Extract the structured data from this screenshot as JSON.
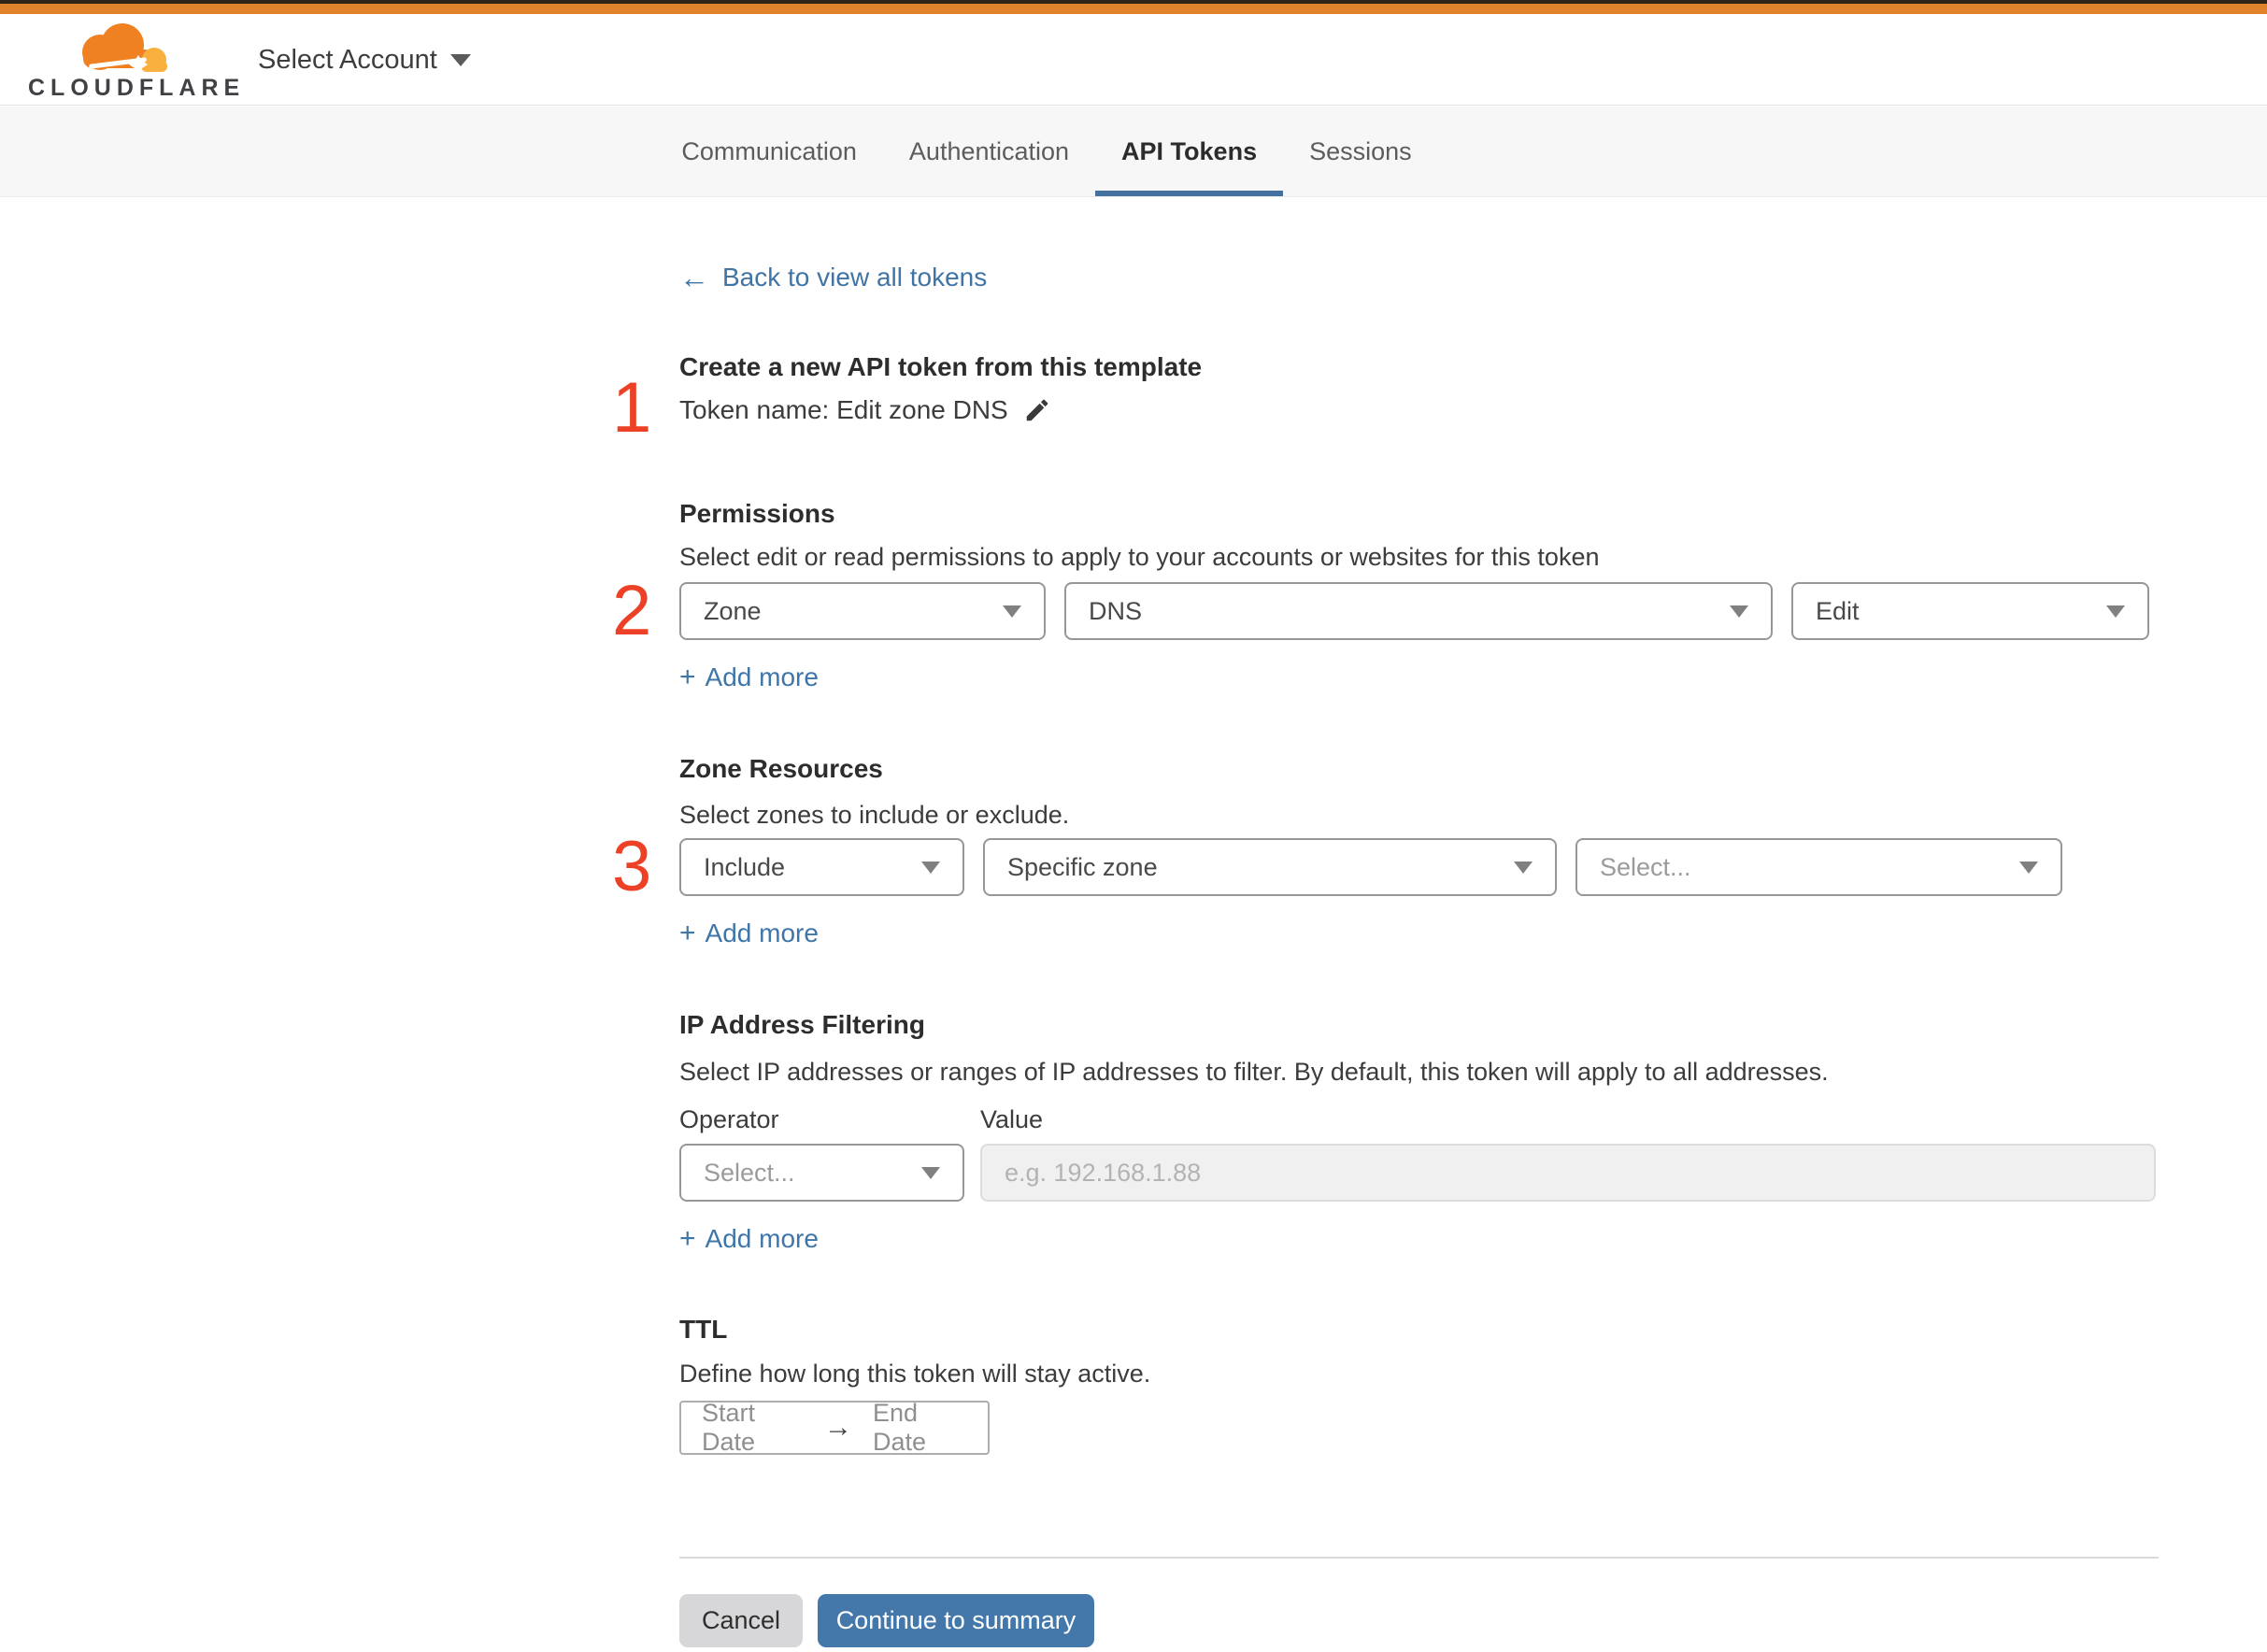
{
  "header": {
    "logo_text": "CLOUDFLARE",
    "account_selector": {
      "label": "Select Account"
    }
  },
  "tabs": [
    {
      "label": "Communication",
      "active": false
    },
    {
      "label": "Authentication",
      "active": false
    },
    {
      "label": "API Tokens",
      "active": true
    },
    {
      "label": "Sessions",
      "active": false
    }
  ],
  "back_link": {
    "arrow": "←",
    "label": "Back to view all tokens"
  },
  "create_section": {
    "step_number": "1",
    "title": "Create a new API token from this template",
    "token_name": "Token name: Edit zone DNS"
  },
  "permissions": {
    "step_number": "2",
    "title": "Permissions",
    "description": "Select edit or read permissions to apply to your accounts or websites for this token",
    "scope_value": "Zone",
    "service_value": "DNS",
    "access_value": "Edit",
    "add_more": {
      "plus": "+",
      "label": "Add more"
    }
  },
  "zone_resources": {
    "step_number": "3",
    "title": "Zone Resources",
    "description": "Select zones to include or exclude.",
    "operator_value": "Include",
    "type_value": "Specific zone",
    "zone_placeholder": "Select...",
    "add_more": {
      "plus": "+",
      "label": "Add more"
    }
  },
  "ip_filtering": {
    "title": "IP Address Filtering",
    "description": "Select IP addresses or ranges of IP addresses to filter. By default, this token will apply to all addresses.",
    "operator_label": "Operator",
    "value_label": "Value",
    "operator_placeholder": "Select...",
    "value_placeholder": "e.g. 192.168.1.88",
    "add_more": {
      "plus": "+",
      "label": "Add more"
    }
  },
  "ttl": {
    "title": "TTL",
    "description": "Define how long this token will stay active.",
    "start_label": "Start Date",
    "arrow": "→",
    "end_label": "End Date"
  },
  "footer": {
    "cancel_label": "Cancel",
    "continue_label": "Continue to summary"
  },
  "colors": {
    "accent_orange": "#e0812c",
    "brand_orange": "#ef8122",
    "brand_orange_light": "#f9b03f",
    "link_blue": "#3f76a9",
    "button_blue": "#4478ab",
    "step_number_red": "#ec4126",
    "tab_underline_blue": "#44719f"
  }
}
